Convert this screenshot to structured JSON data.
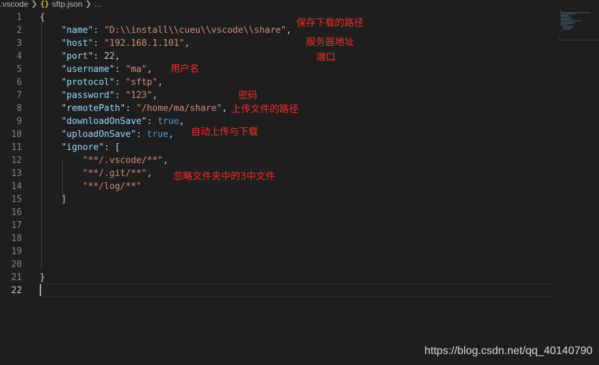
{
  "breadcrumb": {
    "folder": ".vscode",
    "file_icon": "{}",
    "file": "sftp.json",
    "more": "..."
  },
  "editor": {
    "line_numbers": [
      "1",
      "2",
      "3",
      "4",
      "5",
      "6",
      "7",
      "8",
      "9",
      "10",
      "11",
      "12",
      "13",
      "14",
      "15",
      "16",
      "17",
      "18",
      "19",
      "20",
      "21",
      "22"
    ],
    "active_line": "22",
    "lines": {
      "l1": {
        "brace": "{"
      },
      "l2": {
        "key": "\"name\"",
        "colon": ": ",
        "val": "\"D:\\\\install\\\\cueu\\\\vscode\\\\share\"",
        "comma": ","
      },
      "l3": {
        "key": "\"host\"",
        "colon": ": ",
        "val": "\"192.168.1.101\"",
        "comma": ","
      },
      "l4": {
        "key": "\"port\"",
        "colon": ": ",
        "val": "22",
        "comma": ","
      },
      "l5": {
        "key": "\"username\"",
        "colon": ": ",
        "val": "\"ma\"",
        "comma": ","
      },
      "l6": {
        "key": "\"protocol\"",
        "colon": ": ",
        "val": "\"sftp\"",
        "comma": ","
      },
      "l7": {
        "key": "\"password\"",
        "colon": ": ",
        "val": "\"123\"",
        "comma": ","
      },
      "l8": {
        "key": "\"remotePath\"",
        "colon": ": ",
        "val": "\"/home/ma/share\"",
        "comma": ","
      },
      "l9": {
        "key": "\"downloadOnSave\"",
        "colon": ": ",
        "val": "true",
        "comma": ","
      },
      "l10": {
        "key": "\"uploadOnSave\"",
        "colon": ": ",
        "val": "true",
        "comma": ","
      },
      "l11": {
        "key": "\"ignore\"",
        "colon": ": ",
        "bracket": "["
      },
      "l12": {
        "val": "\"**/.vscode/**\"",
        "comma": ","
      },
      "l13": {
        "val": "\"**/.git/**\"",
        "comma": ","
      },
      "l14": {
        "val": "\"**/log/**\""
      },
      "l15": {
        "bracket": "]"
      },
      "l21": {
        "brace": "}"
      }
    }
  },
  "annotations": {
    "save_path": "保存下载的路径",
    "server_address": "服务器地址",
    "port": "端口",
    "username": "用户名",
    "password": "密码",
    "upload_path": "上传文件的路径",
    "auto_sync": "自动上传与下载",
    "ignore_note": "忽略文件夹中的3中文件"
  },
  "watermark": "https://blog.csdn.net/qq_40140790",
  "colors": {
    "background": "#1e1e1e",
    "key": "#9cdcfe",
    "string": "#ce9178",
    "number": "#b5cea8",
    "boolean": "#569cd6",
    "annotation": "#f0302c",
    "line_number": "#858585"
  }
}
